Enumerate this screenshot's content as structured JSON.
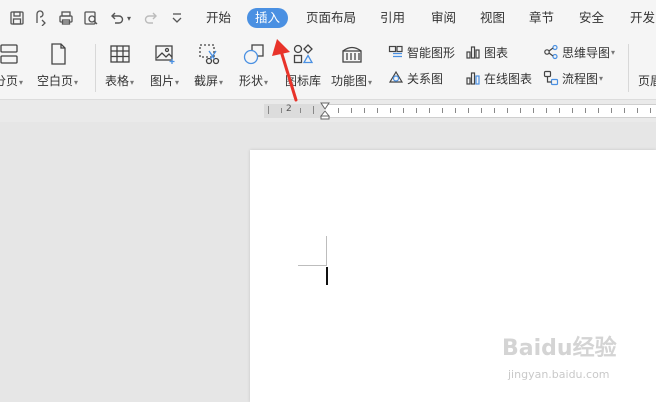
{
  "menu_tabs": [
    "开始",
    "插入",
    "页面布局",
    "引用",
    "审阅",
    "视图",
    "章节",
    "安全",
    "开发"
  ],
  "active_tab": "插入",
  "ribbon": {
    "fenye": "分页",
    "kongbai": "空白页",
    "biaoge": "表格",
    "tupian": "图片",
    "jieping": "截屏",
    "xingzhuang": "形状",
    "tubiaoku": "图标库",
    "gongnengtu": "功能图",
    "zhineng": "智能图形",
    "guanxi": "关系图",
    "tubiao": "图表",
    "zaixian": "在线图表",
    "siwei": "思维导图",
    "liucheng": "流程图",
    "yemei": "页眉"
  },
  "ruler": {
    "label": "2"
  },
  "watermark": {
    "brand": "Baidu经验",
    "url": "jingyan.baidu.com"
  },
  "colors": {
    "accent": "#4a90e2",
    "arrow": "#e8332a"
  }
}
